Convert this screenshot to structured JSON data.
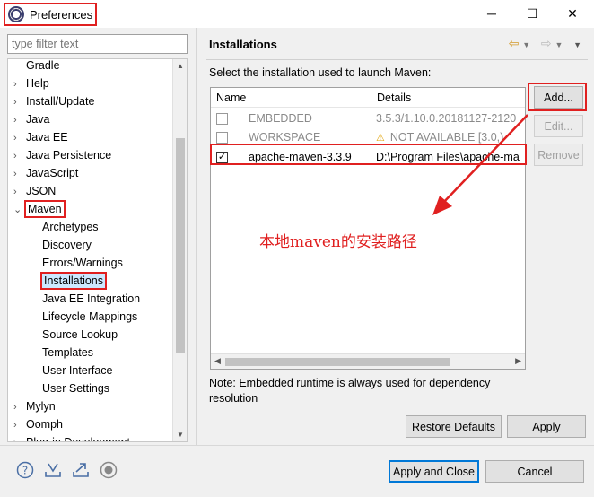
{
  "window": {
    "title": "Preferences"
  },
  "filter": {
    "placeholder": "type filter text"
  },
  "tree": [
    {
      "label": "Gradle",
      "level": 0,
      "twisty": ""
    },
    {
      "label": "Help",
      "level": 0,
      "twisty": "›"
    },
    {
      "label": "Install/Update",
      "level": 0,
      "twisty": "›"
    },
    {
      "label": "Java",
      "level": 0,
      "twisty": "›"
    },
    {
      "label": "Java EE",
      "level": 0,
      "twisty": "›"
    },
    {
      "label": "Java Persistence",
      "level": 0,
      "twisty": "›"
    },
    {
      "label": "JavaScript",
      "level": 0,
      "twisty": "›"
    },
    {
      "label": "JSON",
      "level": 0,
      "twisty": "›"
    },
    {
      "label": "Maven",
      "level": 0,
      "twisty": "⌄"
    },
    {
      "label": "Archetypes",
      "level": 1,
      "twisty": ""
    },
    {
      "label": "Discovery",
      "level": 1,
      "twisty": ""
    },
    {
      "label": "Errors/Warnings",
      "level": 1,
      "twisty": ""
    },
    {
      "label": "Installations",
      "level": 1,
      "twisty": ""
    },
    {
      "label": "Java EE Integration",
      "level": 1,
      "twisty": ""
    },
    {
      "label": "Lifecycle Mappings",
      "level": 1,
      "twisty": ""
    },
    {
      "label": "Source Lookup",
      "level": 1,
      "twisty": ""
    },
    {
      "label": "Templates",
      "level": 1,
      "twisty": ""
    },
    {
      "label": "User Interface",
      "level": 1,
      "twisty": ""
    },
    {
      "label": "User Settings",
      "level": 1,
      "twisty": ""
    },
    {
      "label": "Mylyn",
      "level": 0,
      "twisty": "›"
    },
    {
      "label": "Oomph",
      "level": 0,
      "twisty": "›"
    },
    {
      "label": "Plug-in Development",
      "level": 0,
      "twisty": "›"
    }
  ],
  "page": {
    "title": "Installations",
    "description": "Select the installation used to launch Maven:",
    "note": "Note: Embedded runtime is always used for dependency resolution"
  },
  "table": {
    "headers": [
      "Name",
      "Details"
    ],
    "rows": [
      {
        "name": "EMBEDDED",
        "details": "3.5.3/1.10.0.20181127-2120",
        "checked": false,
        "dim": true,
        "warn": false
      },
      {
        "name": "WORKSPACE",
        "details": "NOT AVAILABLE [3.0,)",
        "checked": false,
        "dim": true,
        "warn": true
      },
      {
        "name": "apache-maven-3.3.9",
        "details": "D:\\Program Files\\apache-ma",
        "checked": true,
        "dim": false,
        "warn": false
      }
    ]
  },
  "buttons": {
    "add": "Add...",
    "edit": "Edit...",
    "remove": "Remove",
    "restore": "Restore Defaults",
    "apply": "Apply",
    "apply_close": "Apply and Close",
    "cancel": "Cancel"
  },
  "annotation": "本地maven的安装路径",
  "colors": {
    "annotation_red": "#e02020",
    "primary_blue": "#0078d7"
  }
}
